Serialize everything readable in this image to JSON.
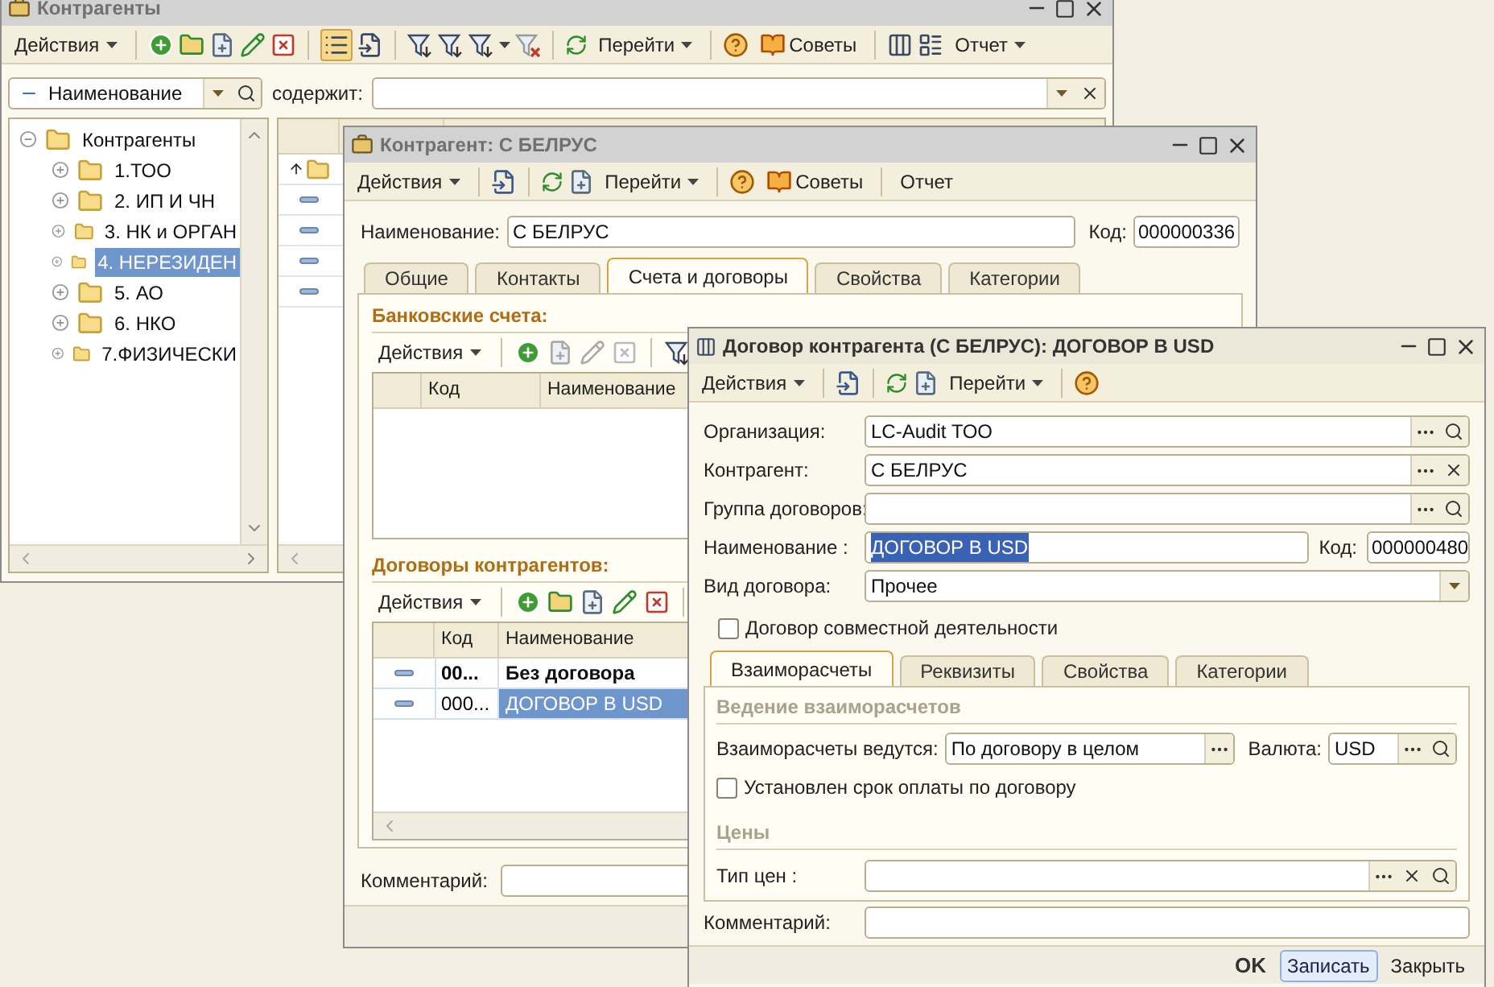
{
  "window_list": {
    "title": "Контрагенты",
    "active": false,
    "toolbar": {
      "actions": "Действия",
      "go_to": "Перейти",
      "tips": "Советы",
      "report": "Отчет"
    },
    "filter": {
      "field": "Наименование",
      "condition_label": "содержит:"
    },
    "tree": [
      {
        "label": "Контрагенты",
        "expanded": true,
        "selected": false,
        "children": [
          {
            "label": "1.ТОО",
            "expanded": false,
            "selected": false
          },
          {
            "label": "2. ИП И ЧН",
            "expanded": false,
            "selected": false
          },
          {
            "label": "3. НК и ОРГАН",
            "expanded": false,
            "selected": false
          },
          {
            "label": "4. НЕРЕЗИДЕН",
            "expanded": false,
            "selected": true
          },
          {
            "label": "5. АО",
            "expanded": false,
            "selected": false
          },
          {
            "label": "6. НКО",
            "expanded": false,
            "selected": false
          },
          {
            "label": "7.ФИЗИЧЕСКИ",
            "expanded": false,
            "selected": false
          }
        ]
      }
    ],
    "list_rows": [
      {
        "kind": "up_folder"
      },
      {
        "kind": "element"
      },
      {
        "kind": "element"
      },
      {
        "kind": "element"
      },
      {
        "kind": "element"
      }
    ]
  },
  "window_counterparty": {
    "title": "Контрагент: С БЕЛРУС",
    "active": false,
    "toolbar": {
      "actions": "Действия",
      "go_to": "Перейти",
      "tips": "Советы",
      "report": "Отчет"
    },
    "name_label": "Наименование:",
    "name_value": "С БЕЛРУС",
    "code_label": "Код:",
    "code_value": "000000336",
    "tabs": [
      {
        "label": "Общие",
        "selected": false
      },
      {
        "label": "Контакты",
        "selected": false
      },
      {
        "label": "Счета и договоры",
        "selected": true
      },
      {
        "label": "Свойства",
        "selected": false
      },
      {
        "label": "Категории",
        "selected": false
      }
    ],
    "bank_accounts": {
      "title": "Банковские счета:",
      "actions": "Действия",
      "columns": [
        "Код",
        "Наименование"
      ]
    },
    "contracts": {
      "title": "Договоры контрагентов:",
      "actions": "Действия",
      "columns": [
        "Код",
        "Наименование"
      ],
      "rows": [
        {
          "code": "00...",
          "name": "Без договора",
          "bold": true,
          "selected": false
        },
        {
          "code": "000...",
          "name": "ДОГОВОР В USD",
          "bold": false,
          "selected": true
        }
      ]
    },
    "comment_label": "Комментарий:"
  },
  "window_contract": {
    "title": "Договор контрагента (С БЕЛРУС): ДОГОВОР В USD",
    "active": true,
    "toolbar": {
      "actions": "Действия",
      "go_to": "Перейти"
    },
    "fields": [
      {
        "label": "Организация:",
        "value": "LC-Audit ТОО",
        "kind": "lookup"
      },
      {
        "label": "Контрагент:",
        "value": "С БЕЛРУС",
        "kind": "clearable"
      },
      {
        "label": "Группа договоров:",
        "kind": "lookup"
      },
      {
        "label": "Наименование :",
        "value": "ДОГОВОР В USD",
        "kind": "name",
        "highlighted": true,
        "code_label": "Код:",
        "code_value": "000000480"
      },
      {
        "label": "Вид договора:",
        "value": "Прочее",
        "kind": "dropdown"
      }
    ],
    "joint_activity": {
      "label": "Договор совместной деятельности",
      "checked": false
    },
    "tabs": [
      {
        "label": "Взаиморасчеты",
        "selected": true
      },
      {
        "label": "Реквизиты",
        "selected": false
      },
      {
        "label": "Свойства",
        "selected": false
      },
      {
        "label": "Категории",
        "selected": false
      }
    ],
    "settlements": {
      "title": "Ведение взаиморасчетов",
      "mode_label": "Взаиморасчеты ведутся:",
      "mode_value": "По договору в целом",
      "currency_label": "Валюта:",
      "currency_value": "USD"
    },
    "payment_term": {
      "label": "Установлен срок оплаты по договору",
      "checked": false
    },
    "prices": {
      "title": "Цены",
      "price_type_label": "Тип цен :"
    },
    "comment_label": "Комментарий:",
    "buttons": [
      {
        "label": "OK",
        "kind": "default"
      },
      {
        "label": "Записать",
        "kind": "focused"
      },
      {
        "label": "Закрыть",
        "kind": "plain"
      }
    ]
  }
}
